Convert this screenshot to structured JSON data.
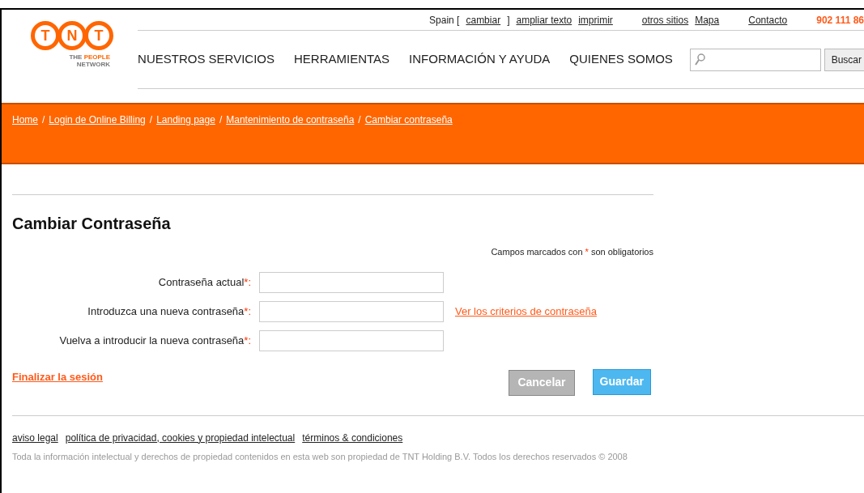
{
  "logo": {
    "letters": [
      "T",
      "N",
      "T"
    ],
    "tagline_1": "THE",
    "tagline_2": "PEOPLE",
    "tagline_3": "NETWORK"
  },
  "top_links": [
    {
      "kind": "text",
      "text": "Spain ["
    },
    {
      "kind": "link",
      "text": "cambiar"
    },
    {
      "kind": "text",
      "text": "]"
    },
    {
      "kind": "link",
      "text": "ampliar texto"
    },
    {
      "kind": "link",
      "text": "imprimir"
    },
    {
      "kind": "gap"
    },
    {
      "kind": "link",
      "text": "otros sitios"
    },
    {
      "kind": "link",
      "text": "Mapa"
    },
    {
      "kind": "gap"
    },
    {
      "kind": "link",
      "text": "Contacto"
    },
    {
      "kind": "gap"
    },
    {
      "kind": "phone",
      "text": "902 111 86"
    }
  ],
  "nav": [
    "NUESTROS SERVICIOS",
    "HERRAMIENTAS",
    "INFORMACIÓN Y AYUDA",
    "QUIENES SOMOS"
  ],
  "search": {
    "button": "Buscar"
  },
  "breadcrumb": [
    "Home",
    "Login de Online Billing",
    "Landing page",
    "Mantenimiento de contraseña",
    "Cambiar contraseña"
  ],
  "breadcrumb_separator": "/",
  "title": "Cambiar Contraseña",
  "required_note": {
    "before": "Campos marcados con",
    "mark": "*",
    "after": "son obligatorios"
  },
  "fields": [
    {
      "label": "Contraseña actual",
      "mark": "*:"
    },
    {
      "label": "Introduzca una nueva contraseña",
      "mark": "*:",
      "link": "Ver los criterios de contraseña"
    },
    {
      "label": "Vuelva a introducir la nueva contraseña",
      "mark": "*:"
    }
  ],
  "logout": "Finalizar la sesión",
  "buttons": [
    {
      "label": "Cancelar",
      "kind": "secondary"
    },
    {
      "label": "Guardar",
      "kind": "primary"
    }
  ],
  "footer_links": [
    "aviso legal",
    "política de privacidad, cookies y propiedad intelectual",
    "términos & condiciones"
  ],
  "copyright": "Toda la información intelectual y derechos de propiedad contenidos en esta web son propiedad de TNT Holding B.V. Todos los derechos reservados © 2008"
}
